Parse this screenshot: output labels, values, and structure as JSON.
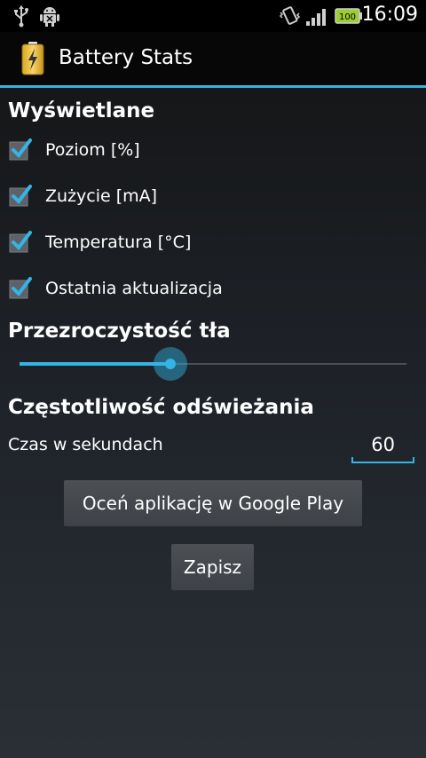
{
  "status_bar": {
    "time": "16:09",
    "battery_level": "100",
    "icons": [
      "usb-icon",
      "android-debug-icon",
      "vibrate-icon",
      "signal-icon",
      "battery-icon"
    ]
  },
  "action_bar": {
    "title": "Battery Stats",
    "icon": "battery-app-icon"
  },
  "displayed": {
    "title": "Wyświetlane",
    "items": [
      {
        "label": "Poziom [%]",
        "checked": true
      },
      {
        "label": "Zużycie [mA]",
        "checked": true
      },
      {
        "label": "Temperatura [°C]",
        "checked": true
      },
      {
        "label": "Ostatnia aktualizacja",
        "checked": true
      }
    ]
  },
  "transparency": {
    "title": "Przezroczystość tła",
    "value_fraction": 0.39
  },
  "refresh": {
    "title": "Częstotliwość odświeżania",
    "label": "Czas w sekundach",
    "value": "60"
  },
  "buttons": {
    "rate_label": "Oceń aplikację w Google Play",
    "save_label": "Zapisz"
  },
  "colors": {
    "accent": "#33b5e5"
  }
}
